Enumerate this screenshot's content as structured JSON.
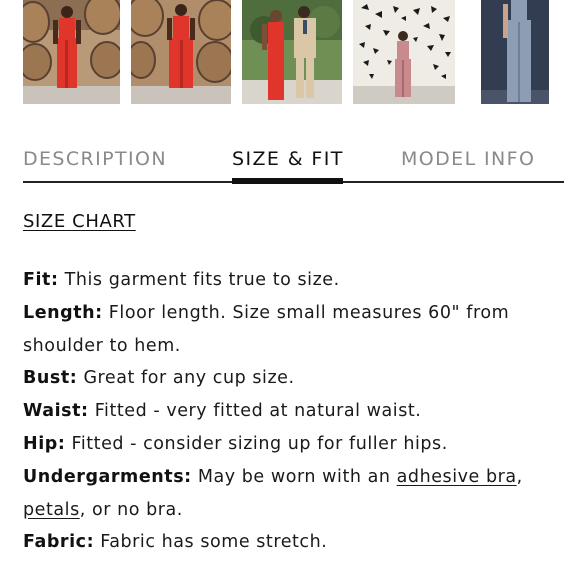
{
  "gallery": {
    "thumbnails": [
      {
        "label": "model-red-jumpsuit-barrels-1"
      },
      {
        "label": "model-red-jumpsuit-barrels-2"
      },
      {
        "label": "model-red-jumpsuit-with-partner"
      },
      {
        "label": "model-pink-jumpsuit-butterfly-wall"
      },
      {
        "label": "model-blue-jumpsuit"
      }
    ]
  },
  "tabs": {
    "description": "DESCRIPTION",
    "size_fit": "SIZE & FIT",
    "model_info": "MODEL INFO",
    "active": "size_fit"
  },
  "size_chart_link": "SIZE CHART",
  "details": {
    "fit": {
      "label": "Fit:",
      "text": " This garment fits true to size."
    },
    "length": {
      "label": "Length:",
      "text": " Floor length. Size small measures 60\" from shoulder to hem."
    },
    "bust": {
      "label": "Bust:",
      "text": " Great for any cup size."
    },
    "waist": {
      "label": "Waist:",
      "text": " Fitted - very fitted at natural waist."
    },
    "hip": {
      "label": "Hip:",
      "text": " Fitted - consider sizing up for fuller hips."
    },
    "undergarments": {
      "label": "Undergarments:",
      "text_before": " May be worn with an ",
      "link1": "adhesive bra",
      "text_mid": ", ",
      "link2": "petals",
      "text_after": ", or no bra."
    },
    "fabric": {
      "label": "Fabric:",
      "text": " Fabric has some stretch."
    }
  },
  "colors": {
    "active_tab": "#111111",
    "inactive_tab": "#8a8a8a",
    "divider": "#222222",
    "jumpsuit_red": "#e0352b",
    "jumpsuit_pink": "#c98a8e",
    "jumpsuit_blue": "#8d9db3"
  }
}
